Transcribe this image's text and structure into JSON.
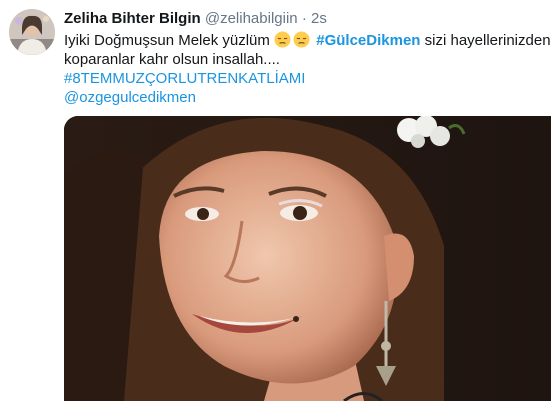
{
  "tweet": {
    "author_name": "Zeliha Bihter Bilgin",
    "author_handle": "@zelihabilgiin",
    "separator": "·",
    "time": "2s",
    "line1_text_a": "Iyiki Doğmuşsun Melek yüzlüm",
    "line1_hashtag": "#GülceDikmen",
    "line1_text_b": "sizi hayellerinizden",
    "line2_text": "koparanlar  kahr olsun insallah....",
    "hashtag_line": "#8TEMMUZÇORLUTRENKATLİAMI",
    "mention": "@ozgegulcedikmen",
    "emoji_names": [
      "pensive-face-emoji",
      "pensive-face-emoji"
    ]
  },
  "colors": {
    "link": "#1b95e0",
    "secondary_text": "#657786",
    "primary_text": "#14171a"
  }
}
